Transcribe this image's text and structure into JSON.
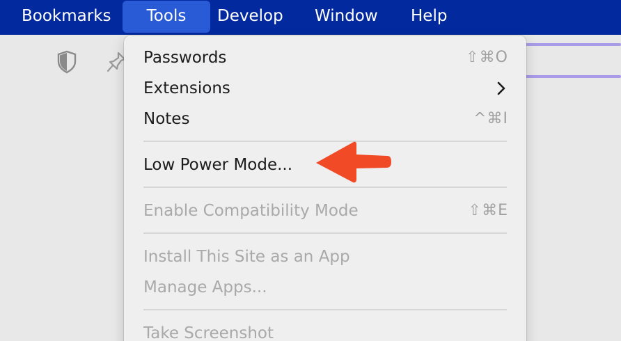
{
  "menubar": {
    "items": [
      {
        "label": "Bookmarks"
      },
      {
        "label": "Tools"
      },
      {
        "label": "Develop"
      },
      {
        "label": "Window"
      },
      {
        "label": "Help"
      }
    ],
    "active": "Tools",
    "background_color": "#022a9e",
    "active_color": "#2a5bd7"
  },
  "toolbar": {
    "icons": [
      "shield-icon",
      "pin-icon"
    ]
  },
  "tools_menu": {
    "items": [
      {
        "label": "Passwords",
        "shortcut": "⇧⌘O",
        "enabled": true
      },
      {
        "label": "Extensions",
        "submenu": true,
        "enabled": true
      },
      {
        "label": "Notes",
        "shortcut": "^⌘I",
        "enabled": true
      },
      {
        "label": "Low Power Mode...",
        "enabled": true,
        "highlighted_by_arrow": true
      },
      {
        "label": "Enable Compatibility Mode",
        "shortcut": "⇧⌘E",
        "enabled": false
      },
      {
        "label": "Install This Site as an App",
        "enabled": false
      },
      {
        "label": "Manage Apps...",
        "enabled": false
      },
      {
        "label": "Take Screenshot",
        "enabled": false
      }
    ]
  },
  "annotation": {
    "type": "arrow",
    "color": "#f04a26",
    "points_to": "Low Power Mode..."
  }
}
